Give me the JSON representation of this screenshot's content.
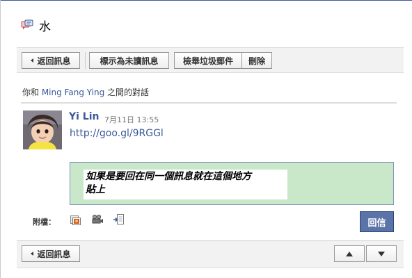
{
  "thread": {
    "title": "水",
    "title_icon": "message-bubbles-icon"
  },
  "toolbar": {
    "back_label": "返回訊息",
    "mark_unread_label": "標示為未讀訊息",
    "report_spam_label": "檢舉垃圾郵件",
    "delete_label": "刪除"
  },
  "conversation": {
    "prefix": "你和 ",
    "participant": "Ming Fang Ying",
    "suffix": " 之間的對話"
  },
  "message": {
    "author": "Yi Lin",
    "timestamp": "7月11日 13:55",
    "body_link": "http://goo.gl/9RGGl"
  },
  "reply": {
    "text_line1": "如果是要回在同一個訊息就在這個地方",
    "text_line2": "貼上",
    "reply_button": "回信",
    "highlight_color": "#c9e7c9"
  },
  "attachments": {
    "label": "附檔：",
    "icons": [
      "photo-icon",
      "video-icon",
      "share-link-icon"
    ]
  },
  "bottom_bar": {
    "back_label": "返回訊息",
    "up_icon": "arrow-up-icon",
    "down_icon": "arrow-down-icon"
  },
  "colors": {
    "brand": "#3b5998",
    "reply_button": "#5b74a8"
  }
}
